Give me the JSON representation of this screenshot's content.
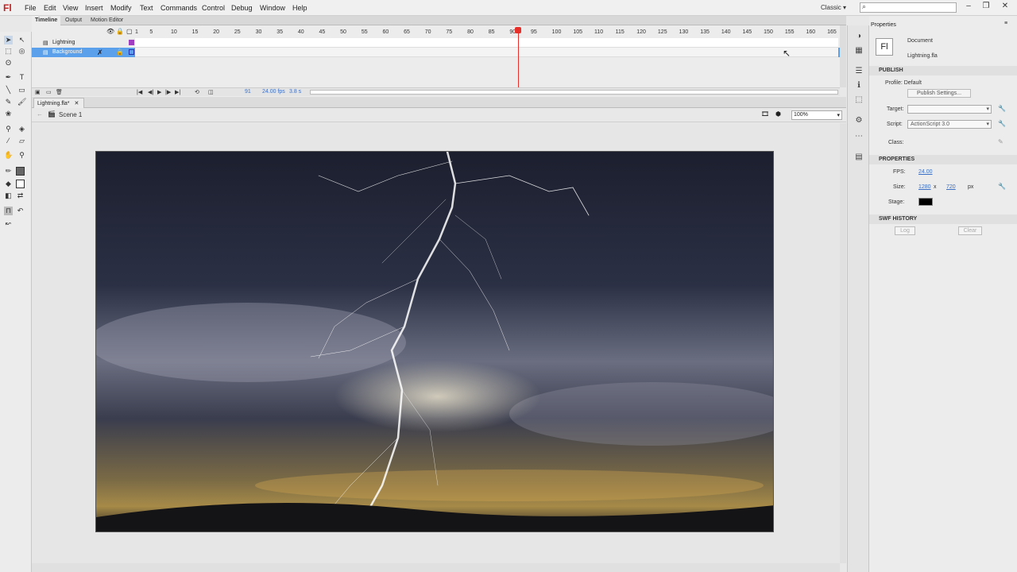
{
  "app": {
    "logo": "Fl",
    "workspace": "Classic",
    "window_controls": [
      "–",
      "❐",
      "✕"
    ]
  },
  "menu": [
    "File",
    "Edit",
    "View",
    "Insert",
    "Modify",
    "Text",
    "Commands",
    "Control",
    "Debug",
    "Window",
    "Help"
  ],
  "timeline_tabs": [
    "Timeline",
    "Output",
    "Motion Editor"
  ],
  "layers": [
    {
      "name": "Lightning",
      "selected": false
    },
    {
      "name": "Background",
      "selected": true
    }
  ],
  "ruler_ticks": [
    "1",
    "5",
    "10",
    "15",
    "20",
    "25",
    "30",
    "35",
    "40",
    "45",
    "50",
    "55",
    "60",
    "65",
    "70",
    "75",
    "80",
    "85",
    "90",
    "95",
    "100",
    "105",
    "110",
    "115",
    "120",
    "125",
    "130",
    "135",
    "140",
    "145",
    "150",
    "155",
    "160",
    "165"
  ],
  "timeline_footer": {
    "frame": "91",
    "fps": "24.00 fps",
    "time": "3.8 s"
  },
  "document": {
    "tab": "Lightning.fla*",
    "scene": "Scene 1",
    "zoom": "100%"
  },
  "properties": {
    "tab": "Properties",
    "doc_type": "Document",
    "file_name": "Lightning.fla",
    "publish_header": "PUBLISH",
    "profile": "Profile: Default",
    "publish_settings": "Publish Settings...",
    "target_label": "Target:",
    "script_label": "Script:",
    "script_value": "ActionScript 3.0",
    "class_label": "Class:",
    "properties_header": "PROPERTIES",
    "fps_label": "FPS:",
    "fps_value": "24.00",
    "size_label": "Size:",
    "width": "1280",
    "x_sep": "x",
    "height": "720",
    "unit": "px",
    "stage_label": "Stage:",
    "swf_header": "SWF HISTORY",
    "log_btn": "Log",
    "clear_btn": "Clear"
  }
}
